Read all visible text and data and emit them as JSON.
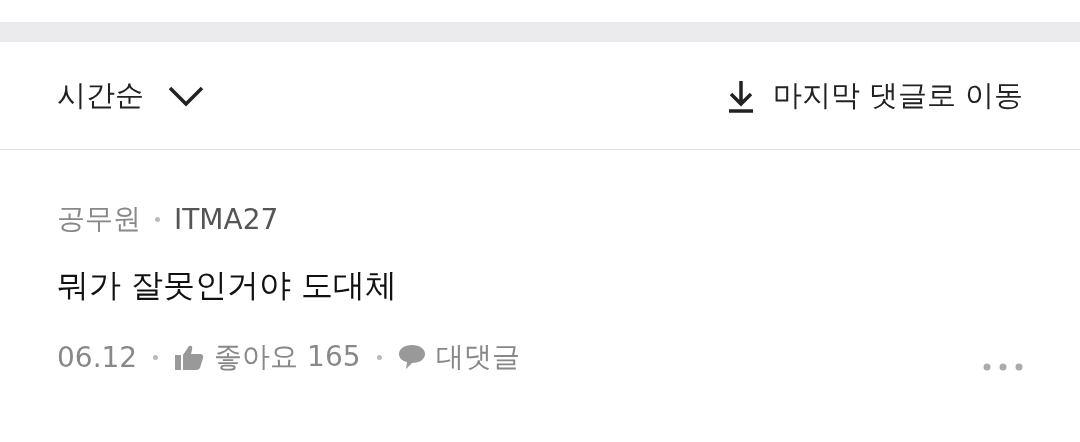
{
  "sort": {
    "label": "시간순"
  },
  "jump": {
    "label": "마지막 댓글로 이동"
  },
  "comment": {
    "category": "공무원",
    "author": "ITMA27",
    "text": "뭐가 잘못인거야 도대체",
    "date": "06.12",
    "like_label": "좋아요 165",
    "reply_label": "대댓글"
  }
}
